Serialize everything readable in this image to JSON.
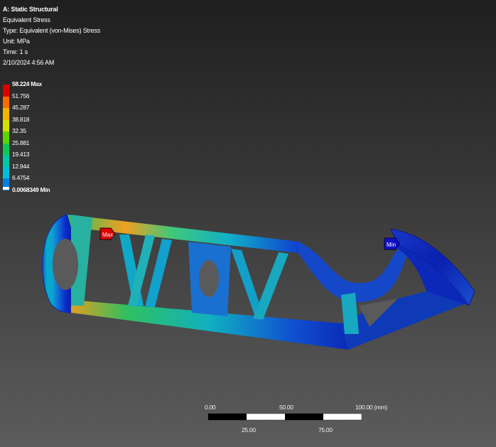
{
  "header": {
    "title": "A: Static Structural",
    "result": "Equivalent Stress",
    "type": "Type: Equivalent (von-Mises) Stress",
    "unit": "Unit: MPa",
    "time": "Time: 1 s",
    "date": "2/10/2024 4:56 AM"
  },
  "legend": {
    "levels": [
      {
        "label": "58.224 Max",
        "color": "#e00000",
        "bold": true
      },
      {
        "label": "51.756",
        "color": "#ff6a00",
        "bold": false
      },
      {
        "label": "45.287",
        "color": "#f2b400",
        "bold": false
      },
      {
        "label": "38.818",
        "color": "#d4e000",
        "bold": false
      },
      {
        "label": "32.35",
        "color": "#5fd400",
        "bold": false
      },
      {
        "label": "25.881",
        "color": "#10c850",
        "bold": false
      },
      {
        "label": "19.413",
        "color": "#00c8a0",
        "bold": false
      },
      {
        "label": "12.944",
        "color": "#00c0d8",
        "bold": false
      },
      {
        "label": "6.4754",
        "color": "#0080e0",
        "bold": false
      },
      {
        "label": "0.0068349 Min",
        "color": "#1010c8",
        "bold": true
      }
    ]
  },
  "probes": {
    "max_label": "Max",
    "min_label": "Min"
  },
  "scale_bar": {
    "top_labels": [
      "0.00",
      "50.00",
      "100.00 (mm)"
    ],
    "bottom_labels": [
      "25.00",
      "75.00"
    ]
  }
}
